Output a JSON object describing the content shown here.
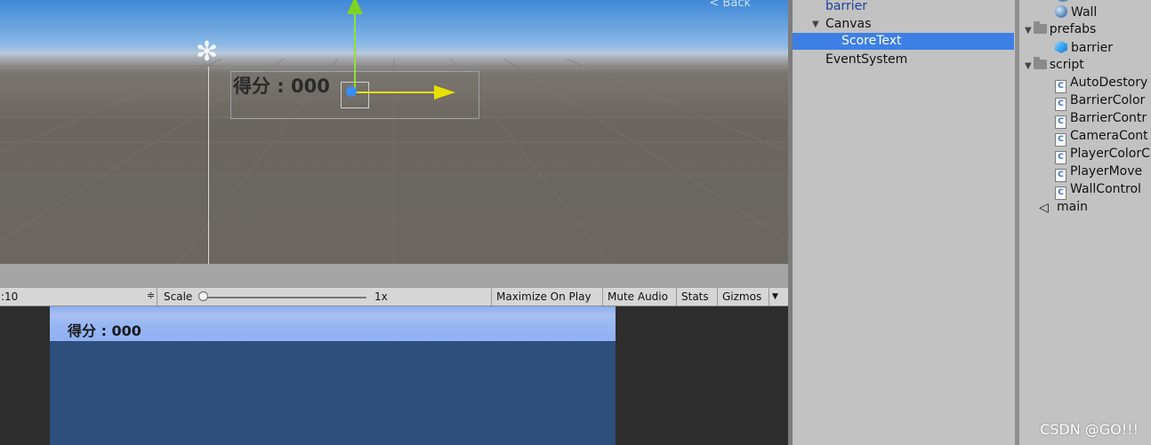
{
  "scene": {
    "back_label": "< Back",
    "score_text": "得分 : 000"
  },
  "game_toolbar": {
    "aspect_value": ":10",
    "aspect_arrow": "≑",
    "scale_label": "Scale",
    "scale_value": "1x",
    "maximize_on_play": "Maximize On Play",
    "mute_audio": "Mute Audio",
    "stats": "Stats",
    "gizmos": "Gizmos",
    "gizmos_arrow": "▼",
    "panel_menu_icon": "≡"
  },
  "game_view": {
    "score_text": "得分 : 000"
  },
  "hierarchy": {
    "items": [
      {
        "label": "barrier"
      },
      {
        "label": "Canvas",
        "arrow": "▼"
      },
      {
        "label": "ScoreText",
        "selected": true
      },
      {
        "label": "EventSystem"
      }
    ]
  },
  "project": {
    "items": [
      {
        "label": "Wall",
        "icon": "sphere-icon"
      },
      {
        "label": "prefabs",
        "icon": "folder-icon",
        "arrow": "▼"
      },
      {
        "label": "barrier",
        "icon": "cube-icon"
      },
      {
        "label": "script",
        "icon": "folder-icon",
        "arrow": "▼"
      },
      {
        "label": "AutoDestory",
        "icon": "csharp-script-icon"
      },
      {
        "label": "BarrierColor",
        "icon": "csharp-script-icon"
      },
      {
        "label": "BarrierContr",
        "icon": "csharp-script-icon"
      },
      {
        "label": "CameraCont",
        "icon": "csharp-script-icon"
      },
      {
        "label": "PlayerColorC",
        "icon": "csharp-script-icon"
      },
      {
        "label": "PlayerMove",
        "icon": "csharp-script-icon"
      },
      {
        "label": "WallControl",
        "icon": "csharp-script-icon"
      },
      {
        "label": "main",
        "icon": "unity-scene-icon"
      }
    ]
  },
  "watermark": "CSDN @GO!!!",
  "colors": {
    "selection": "#3d7fe6",
    "axis_y": "#7ed321",
    "axis_x": "#e8e000",
    "pivot": "#3a8df2",
    "game_background": "#2e4e7c"
  }
}
